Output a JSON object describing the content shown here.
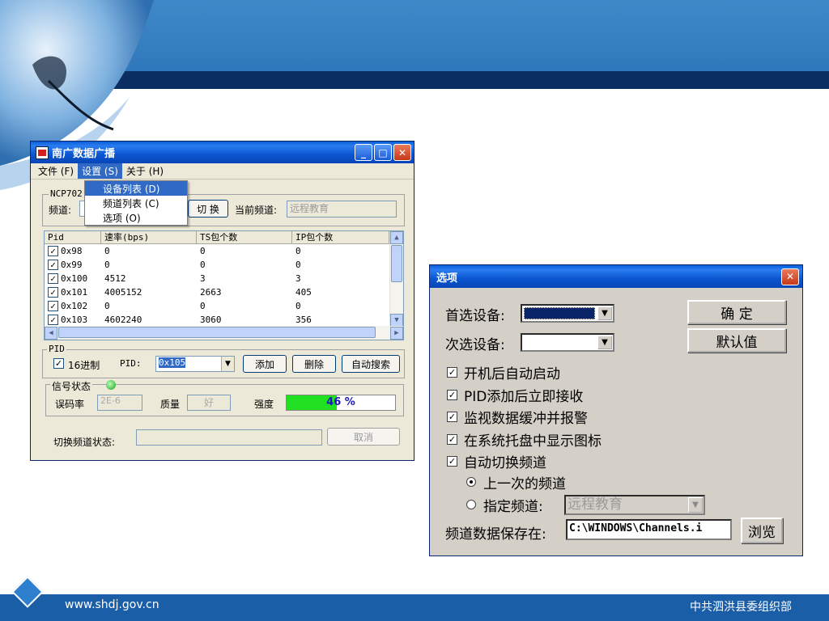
{
  "footer": {
    "url": "www.shdj.gov.cn",
    "org": "中共泗洪县委组织部"
  },
  "colors": {
    "slide_blue": "#2f78bb",
    "dark_stripe": "#0b2e62",
    "xp_title": "#0b56d0",
    "progress": "#22e022"
  },
  "main_window": {
    "title": "南广数据广播",
    "menu": {
      "file": "文件 (F)",
      "settings": "设置 (S)",
      "about": "关于 (H)"
    },
    "dropdown": {
      "devices": "设备列表 (D)",
      "channels": "频道列表 (C)",
      "options": "选项 (O)"
    },
    "device_group": "NCP702",
    "channel_label": "频道:",
    "switch_button": "切 换",
    "current_channel_label": "当前频道:",
    "current_channel_value": "远程教育",
    "table": {
      "headers": [
        "Pid",
        "速率(bps)",
        "TS包个数",
        "IP包个数"
      ],
      "rows": [
        {
          "pid": "0x98",
          "rate": "0",
          "ts": "0",
          "ip": "0"
        },
        {
          "pid": "0x99",
          "rate": "0",
          "ts": "0",
          "ip": "0"
        },
        {
          "pid": "0x100",
          "rate": "4512",
          "ts": "3",
          "ip": "3"
        },
        {
          "pid": "0x101",
          "rate": "4005152",
          "ts": "2663",
          "ip": "405"
        },
        {
          "pid": "0x102",
          "rate": "0",
          "ts": "0",
          "ip": "0"
        },
        {
          "pid": "0x103",
          "rate": "4602240",
          "ts": "3060",
          "ip": "356"
        }
      ]
    },
    "pid_group": "PID",
    "hex_label": "16进制",
    "pid_label": "PID:",
    "pid_value": "0x105",
    "add_button": "添加",
    "delete_button": "删除",
    "auto_search_button": "自动搜索",
    "signal_group": "信号状态",
    "ber_label": "误码率",
    "ber_value": "2E-6",
    "quality_label": "质量",
    "quality_value": "好",
    "strength_label": "强度",
    "strength_text": "46 %",
    "strength_value": 46,
    "switch_status_label": "切换频道状态:",
    "cancel_button": "取消"
  },
  "options_dialog": {
    "title": "选项",
    "primary_device_label": "首选设备:",
    "secondary_device_label": "次选设备:",
    "ok_button": "确 定",
    "default_button": "默认值",
    "checkboxes": [
      {
        "label": "开机后自动启动",
        "checked": true
      },
      {
        "label": "PID添加后立即接收",
        "checked": true
      },
      {
        "label": "监视数据缓冲并报警",
        "checked": true
      },
      {
        "label": "在系统托盘中显示图标",
        "checked": true
      },
      {
        "label": "自动切换频道",
        "checked": true
      }
    ],
    "radio_last": "上一次的频道",
    "radio_specified": "指定频道:",
    "specified_channel_value": "远程教育",
    "save_path_label": "频道数据保存在:",
    "save_path_value": "C:\\WINDOWS\\Channels.i",
    "browse_button": "浏览"
  }
}
